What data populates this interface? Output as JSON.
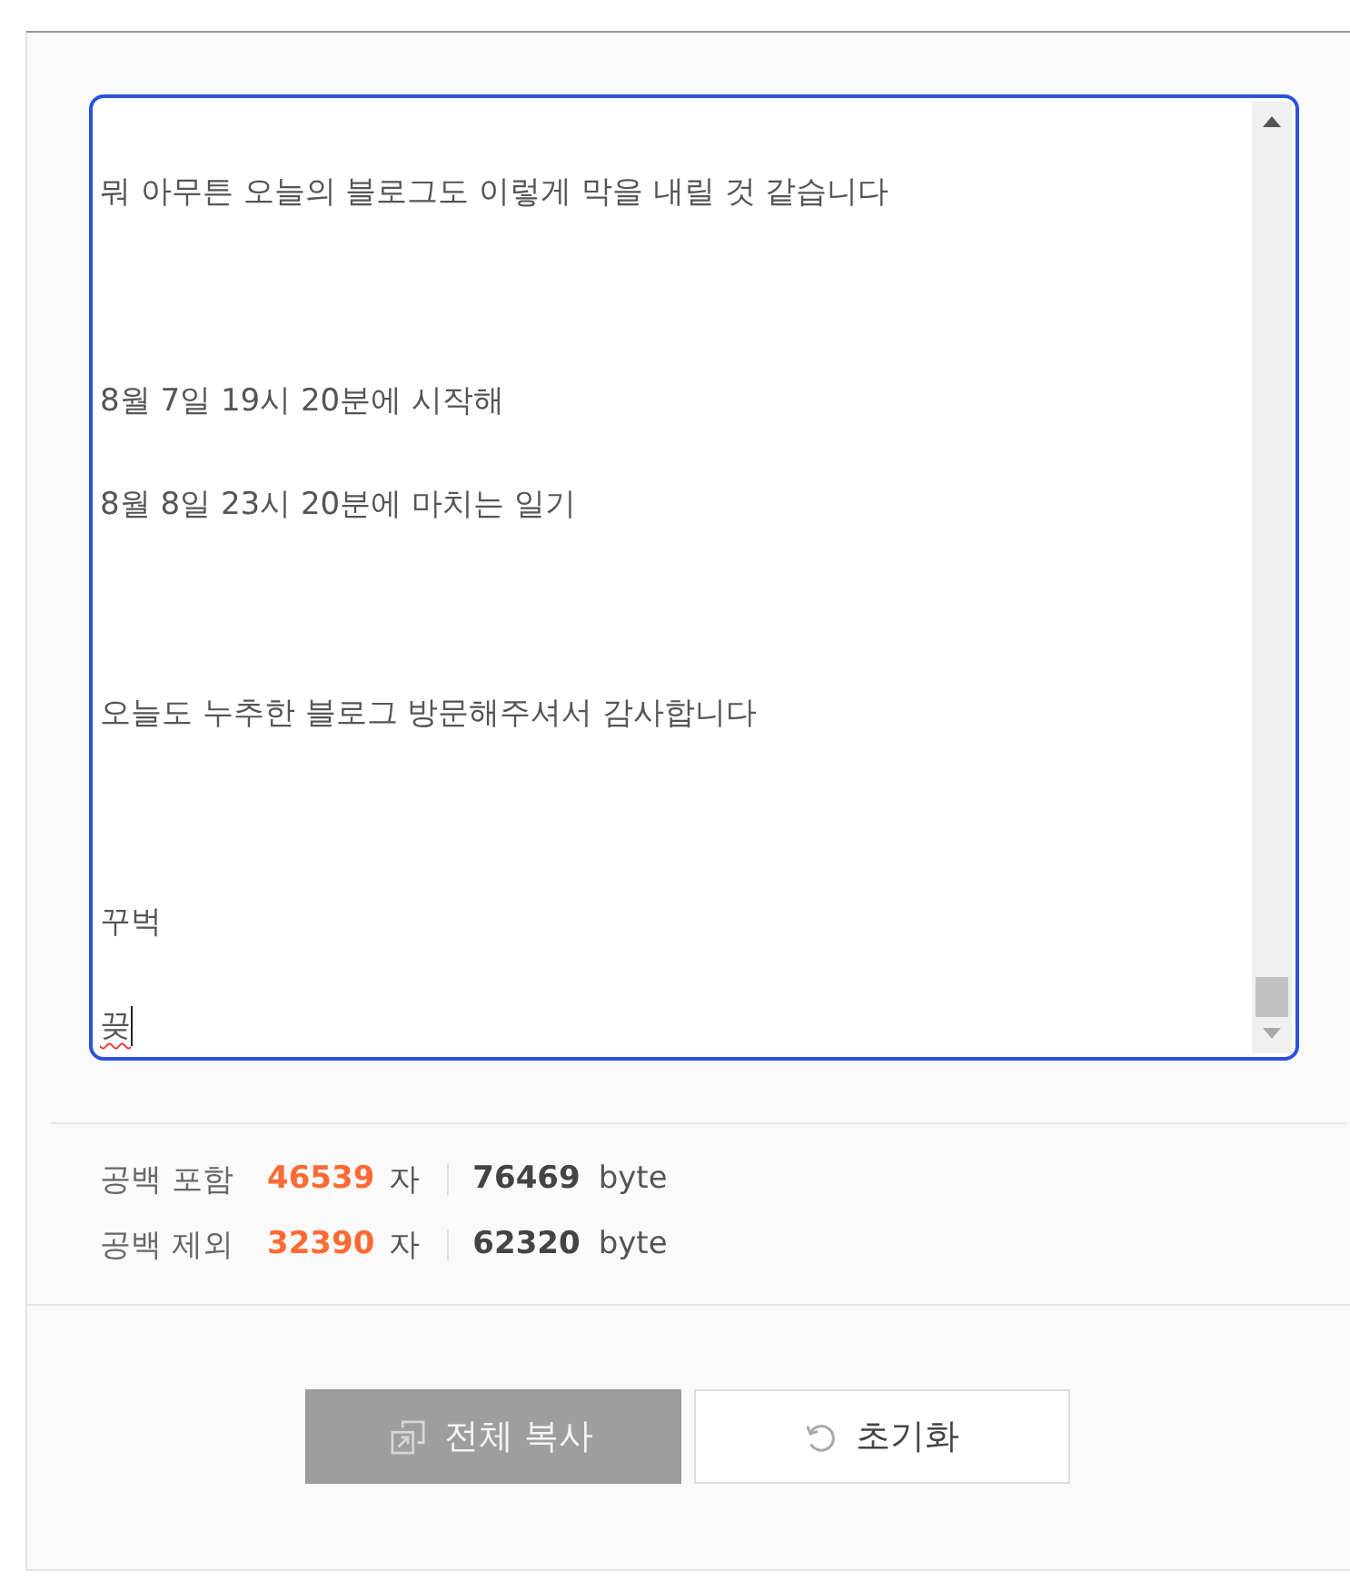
{
  "editor": {
    "focused": true,
    "paragraphs": [
      {
        "lines": [
          {
            "text": "뭐 아무튼 오늘의 블로그도 이렇게 막을 내릴 것 같습니다",
            "misspelled": false,
            "caret": false
          }
        ]
      },
      {
        "lines": [
          {
            "text": "8월 7일 19시 20분에 시작해",
            "misspelled": false,
            "caret": false
          },
          {
            "text": "8월 8일 23시 20분에 마치는 일기",
            "misspelled": false,
            "caret": false
          }
        ]
      },
      {
        "lines": [
          {
            "text": "오늘도 누추한 블로그 방문해주셔서 감사합니다",
            "misspelled": false,
            "caret": false
          }
        ]
      },
      {
        "lines": [
          {
            "text": "꾸벅",
            "misspelled": false,
            "caret": false
          },
          {
            "text": "끚",
            "misspelled": true,
            "caret": true
          }
        ]
      }
    ]
  },
  "stats": [
    {
      "label": "공백 포함",
      "chars": "46539",
      "chars_unit": "자",
      "bytes": "76469",
      "bytes_unit": "byte"
    },
    {
      "label": "공백 제외",
      "chars": "32390",
      "chars_unit": "자",
      "bytes": "62320",
      "bytes_unit": "byte"
    }
  ],
  "buttons": [
    {
      "label": "전체 복사",
      "kind": "copy"
    },
    {
      "label": "초기화",
      "kind": "reset"
    }
  ]
}
